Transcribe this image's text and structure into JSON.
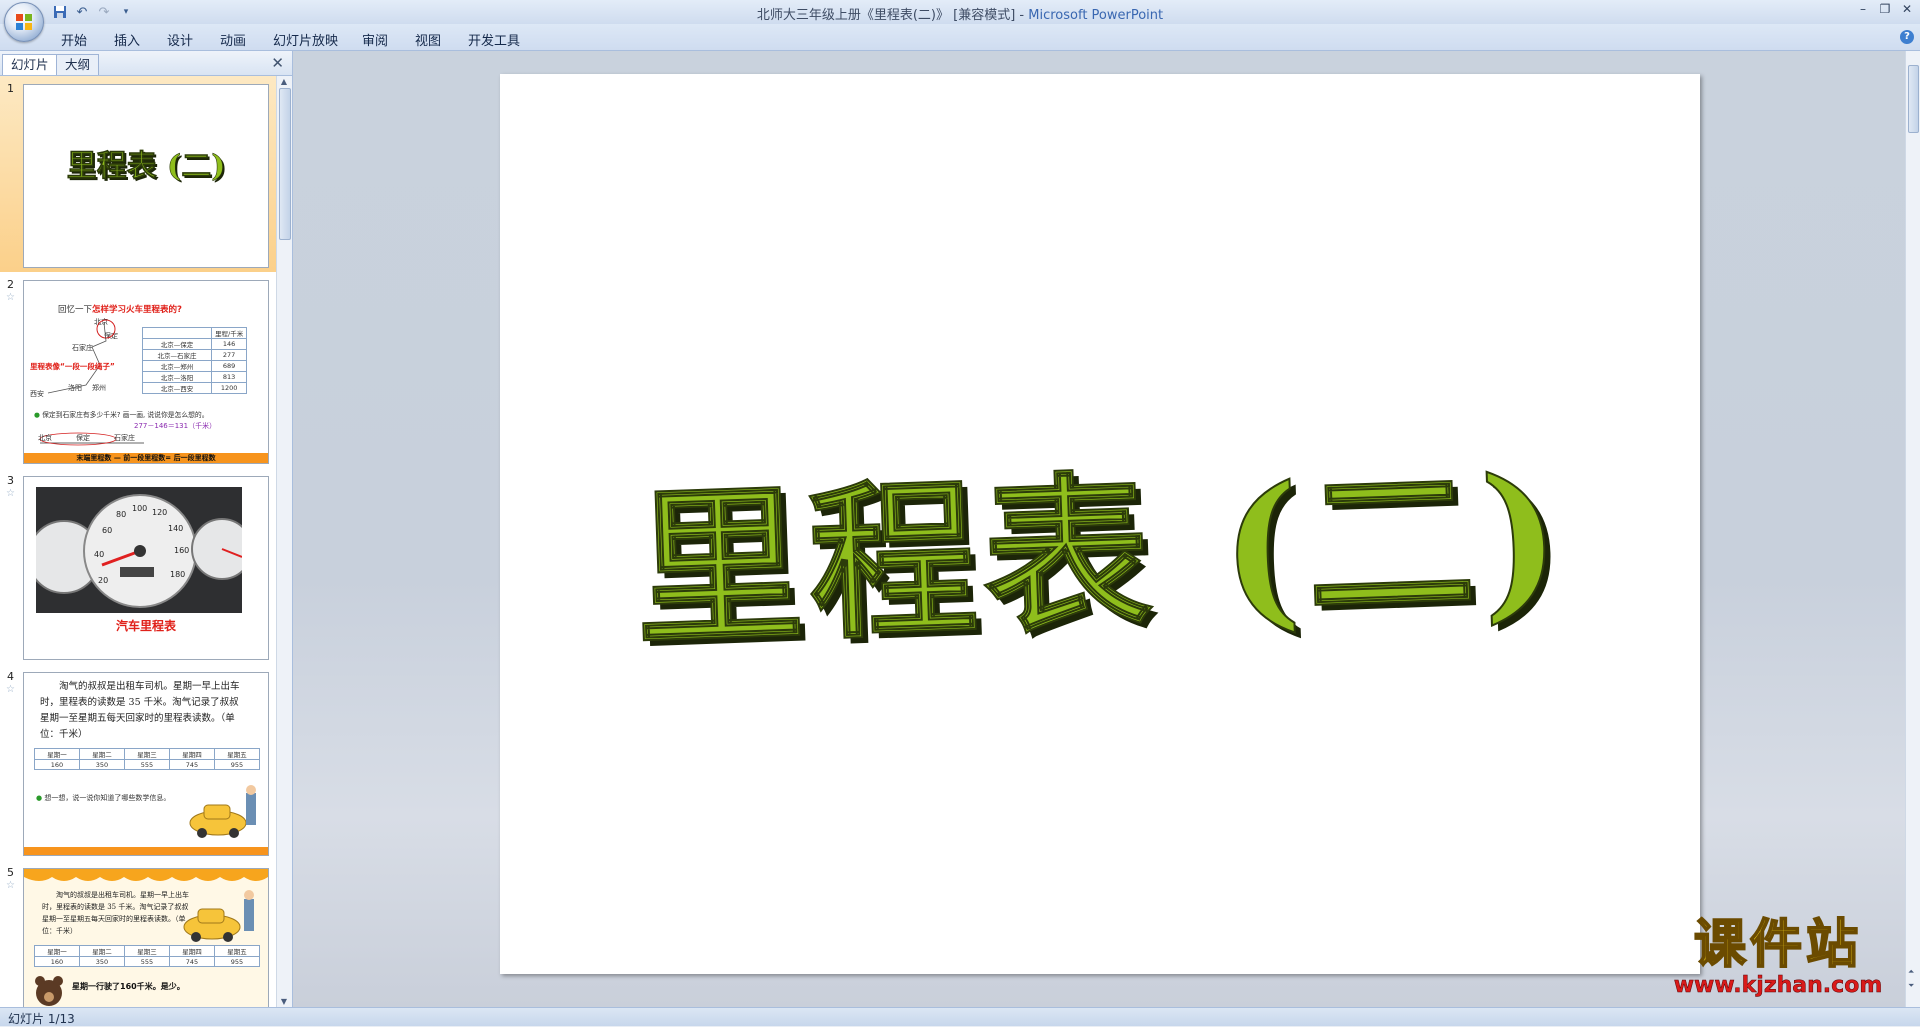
{
  "window": {
    "title_doc": "北师大三年级上册《里程表(二)》 [兼容模式]",
    "title_sep": " - ",
    "title_app": "Microsoft PowerPoint",
    "controls": [
      "–",
      "❐",
      "✕"
    ]
  },
  "ribbon": {
    "tabs": [
      "开始",
      "插入",
      "设计",
      "动画",
      "幻灯片放映",
      "审阅",
      "视图",
      "开发工具"
    ]
  },
  "left_pane": {
    "tabs": [
      "幻灯片",
      "大纲"
    ],
    "slides": [
      {
        "number": "1",
        "title": "里程表 (二)"
      },
      {
        "number": "2",
        "title_prefix": "回忆一下",
        "title_red": "怎样学习火车里程表的?",
        "table_header": "里程/千米",
        "rows": [
          [
            "北京—保定",
            "146"
          ],
          [
            "北京—石家庄",
            "277"
          ],
          [
            "北京—郑州",
            "689"
          ],
          [
            "北京—洛阳",
            "813"
          ],
          [
            "北京—西安",
            "1200"
          ]
        ],
        "cities": [
          "北京",
          "保定",
          "石家庄",
          "郑州",
          "洛阳",
          "西安"
        ],
        "red_note": "里程表像“一段一段绳子”",
        "question": "保定到石家庄有多少千米? 画一画, 说说你是怎么想的。",
        "formula": "277－146＝131（千米）",
        "line_labels": [
          "北京",
          "保定",
          "石家庄"
        ],
        "bottom": "末端里程数 — 前一段里程数= 后一段里程数"
      },
      {
        "number": "3",
        "caption": "汽车里程表",
        "gauge_numbers": [
          "20",
          "40",
          "60",
          "80",
          "100",
          "120",
          "140",
          "160",
          "180"
        ]
      },
      {
        "number": "4",
        "text": "淘气的叔叔是出租车司机。星期一早上出车时，里程表的读数是 35 千米。淘气记录了叔叔星期一至星期五每天回家时的里程表读数。（单位：千米）",
        "headers": [
          "星期一",
          "星期二",
          "星期三",
          "星期四",
          "星期五"
        ],
        "values": [
          "160",
          "350",
          "555",
          "745",
          "955"
        ],
        "prompt": "想一想，说一说你知道了哪些数学信息。"
      },
      {
        "number": "5",
        "text": "淘气的叔叔是出租车司机。星期一早上出车时，里程表的读数是 35 千米。淘气记录了叔叔星期一至星期五每天回家时的里程表读数。（单位：千米）",
        "headers": [
          "星期一",
          "星期二",
          "星期三",
          "星期四",
          "星期五"
        ],
        "values": [
          "160",
          "350",
          "555",
          "745",
          "955"
        ],
        "bubble": "星期一行驶了160千米。是少。"
      }
    ]
  },
  "main_slide": {
    "title": "里程表 (二)"
  },
  "status": {
    "slide_count": "幻灯片 1/13"
  },
  "watermark": {
    "logo": "课件站",
    "url": "www.kjzhan.com"
  },
  "colors": {
    "title_green": "#8fbe1c",
    "selection_orange": "#fbd08a",
    "accent_orange": "#f7941d"
  }
}
